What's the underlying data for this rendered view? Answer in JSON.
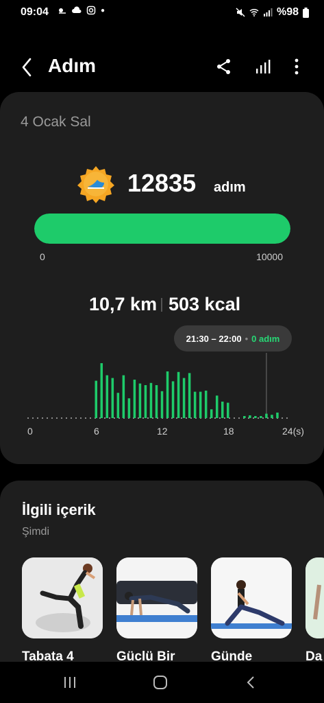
{
  "status": {
    "time": "09:04",
    "battery": "%98"
  },
  "header": {
    "title": "Adım"
  },
  "summary": {
    "date": "4 Ocak Sal",
    "steps": "12835",
    "steps_unit": "adım",
    "goal_progress": 1.0,
    "bar_min": "0",
    "bar_max": "10000",
    "distance": "10,7 km",
    "calories": "503 kcal",
    "tooltip_time": "21:30 – 22:00",
    "tooltip_value": "0 adım"
  },
  "chart_data": {
    "type": "bar",
    "x_ticks": [
      "0",
      "6",
      "12",
      "18",
      "24(s)"
    ],
    "x_range_hours": [
      0,
      24
    ],
    "interval_minutes": 30,
    "values_relative": [
      0,
      0,
      0,
      0,
      0,
      0,
      0,
      0,
      0,
      0,
      0,
      0,
      0.68,
      1.0,
      0.78,
      0.73,
      0.46,
      0.78,
      0.36,
      0.7,
      0.63,
      0.6,
      0.64,
      0.6,
      0.49,
      0.85,
      0.67,
      0.84,
      0.73,
      0.82,
      0.48,
      0.48,
      0.5,
      0.16,
      0.41,
      0.3,
      0.28,
      0,
      0,
      0.03,
      0.05,
      0.03,
      0.03,
      0.08,
      0.06,
      0.1,
      0,
      0
    ],
    "selected_interval": "21:30 – 22:00",
    "accent": "#1ecb6a"
  },
  "related": {
    "title": "İlgili içerik",
    "subtitle": "Şimdi",
    "items": [
      {
        "label": "Tabata 4"
      },
      {
        "label": "Güclü Bir"
      },
      {
        "label": "Günde"
      },
      {
        "label": "Da"
      }
    ]
  },
  "colors": {
    "background": "#000000",
    "card": "#1e1e1e",
    "accent_green": "#1ecb6a",
    "muted_text": "#9a9a9a"
  }
}
